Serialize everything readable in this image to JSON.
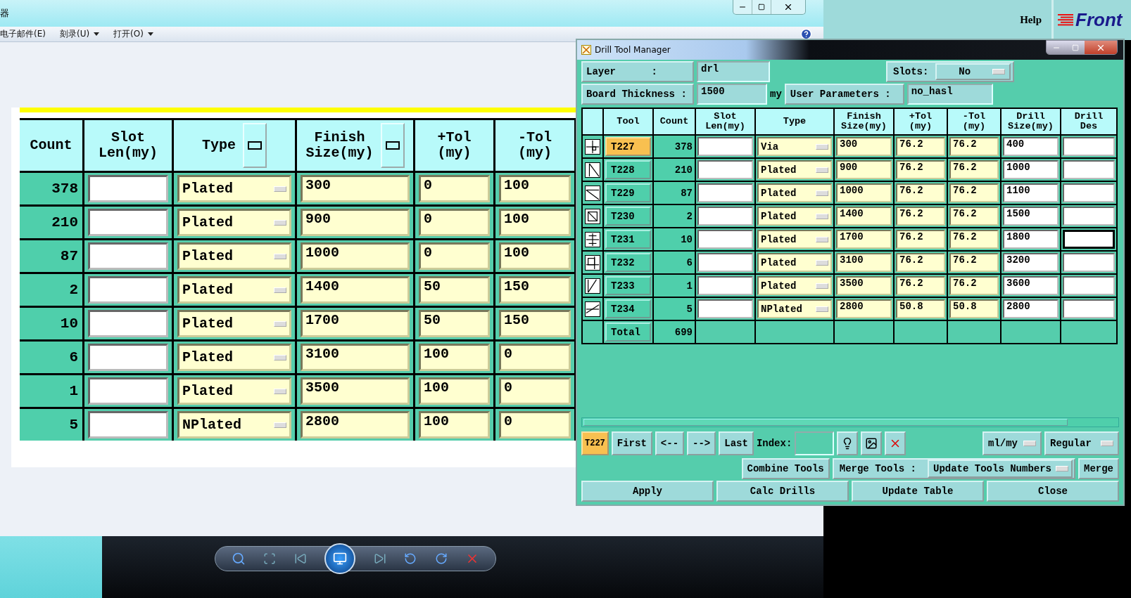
{
  "viewer": {
    "title": "器",
    "menu": [
      {
        "label": "电子邮件(E)",
        "has_dropdown": false
      },
      {
        "label": "刻录(U)",
        "has_dropdown": true
      },
      {
        "label": "打开(O)",
        "has_dropdown": true
      }
    ],
    "image_table": {
      "columns": [
        "Count",
        "Slot\nLen(my)",
        "Type",
        "Finish\nSize(my)",
        "+Tol\n(my)",
        "-Tol\n(my)"
      ],
      "rows": [
        {
          "count": "378",
          "type": "Plated",
          "finish": "300",
          "plus_tol": "0",
          "minus_tol": "100"
        },
        {
          "count": "210",
          "type": "Plated",
          "finish": "900",
          "plus_tol": "0",
          "minus_tol": "100"
        },
        {
          "count": "87",
          "type": "Plated",
          "finish": "1000",
          "plus_tol": "0",
          "minus_tol": "100"
        },
        {
          "count": "2",
          "type": "Plated",
          "finish": "1400",
          "plus_tol": "50",
          "minus_tol": "150"
        },
        {
          "count": "10",
          "type": "Plated",
          "finish": "1700",
          "plus_tol": "50",
          "minus_tol": "150"
        },
        {
          "count": "6",
          "type": "Plated",
          "finish": "3100",
          "plus_tol": "100",
          "minus_tol": "0"
        },
        {
          "count": "1",
          "type": "Plated",
          "finish": "3500",
          "plus_tol": "100",
          "minus_tol": "0"
        },
        {
          "count": "5",
          "type": "NPlated",
          "finish": "2800",
          "plus_tol": "100",
          "minus_tol": "0"
        }
      ]
    }
  },
  "app_header": {
    "help": "Help",
    "logo": "Front"
  },
  "dialog": {
    "title": "Drill Tool Manager",
    "layer_label": "Layer      :",
    "layer": "drl",
    "slots_label": "Slots:",
    "slots": "No",
    "thickness_label": "Board Thickness :",
    "thickness": "1500",
    "thickness_unit": "my",
    "user_params_label": "User Parameters :",
    "user_params": "no_hasl",
    "columns": [
      "Tool",
      "Count",
      "Slot\nLen(my)",
      "Type",
      "Finish\nSize(my)",
      "+Tol\n(my)",
      "-Tol\n(my)",
      "Drill\nSize(my)",
      "Drill\nDes"
    ],
    "tools": [
      {
        "tool": "T227",
        "selected": true,
        "count": "378",
        "type": "Via",
        "finish": "300",
        "plus_tol": "76.2",
        "minus_tol": "76.2",
        "drill_size": "400",
        "focused": false
      },
      {
        "tool": "T228",
        "selected": false,
        "count": "210",
        "type": "Plated",
        "finish": "900",
        "plus_tol": "76.2",
        "minus_tol": "76.2",
        "drill_size": "1000",
        "focused": false
      },
      {
        "tool": "T229",
        "selected": false,
        "count": "87",
        "type": "Plated",
        "finish": "1000",
        "plus_tol": "76.2",
        "minus_tol": "76.2",
        "drill_size": "1100",
        "focused": false
      },
      {
        "tool": "T230",
        "selected": false,
        "count": "2",
        "type": "Plated",
        "finish": "1400",
        "plus_tol": "76.2",
        "minus_tol": "76.2",
        "drill_size": "1500",
        "focused": false
      },
      {
        "tool": "T231",
        "selected": false,
        "count": "10",
        "type": "Plated",
        "finish": "1700",
        "plus_tol": "76.2",
        "minus_tol": "76.2",
        "drill_size": "1800",
        "focused": true
      },
      {
        "tool": "T232",
        "selected": false,
        "count": "6",
        "type": "Plated",
        "finish": "3100",
        "plus_tol": "76.2",
        "minus_tol": "76.2",
        "drill_size": "3200",
        "focused": false
      },
      {
        "tool": "T233",
        "selected": false,
        "count": "1",
        "type": "Plated",
        "finish": "3500",
        "plus_tol": "76.2",
        "minus_tol": "76.2",
        "drill_size": "3600",
        "focused": false
      },
      {
        "tool": "T234",
        "selected": false,
        "count": "5",
        "type": "NPlated",
        "finish": "2800",
        "plus_tol": "50.8",
        "minus_tol": "50.8",
        "drill_size": "2800",
        "focused": false
      }
    ],
    "total": {
      "label": "Total",
      "count": "699"
    },
    "nav": {
      "current": "T227",
      "buttons": [
        "First",
        "<--",
        "-->",
        "Last"
      ],
      "index_label": "Index:",
      "units": "ml/my",
      "mode": "Regular"
    },
    "merge": {
      "combine": "Combine Tools",
      "label": "Merge Tools :",
      "option": "Update Tools Numbers",
      "button": "Merge"
    },
    "actions": [
      "Apply",
      "Calc Drills",
      "Update Table",
      "Close"
    ]
  }
}
